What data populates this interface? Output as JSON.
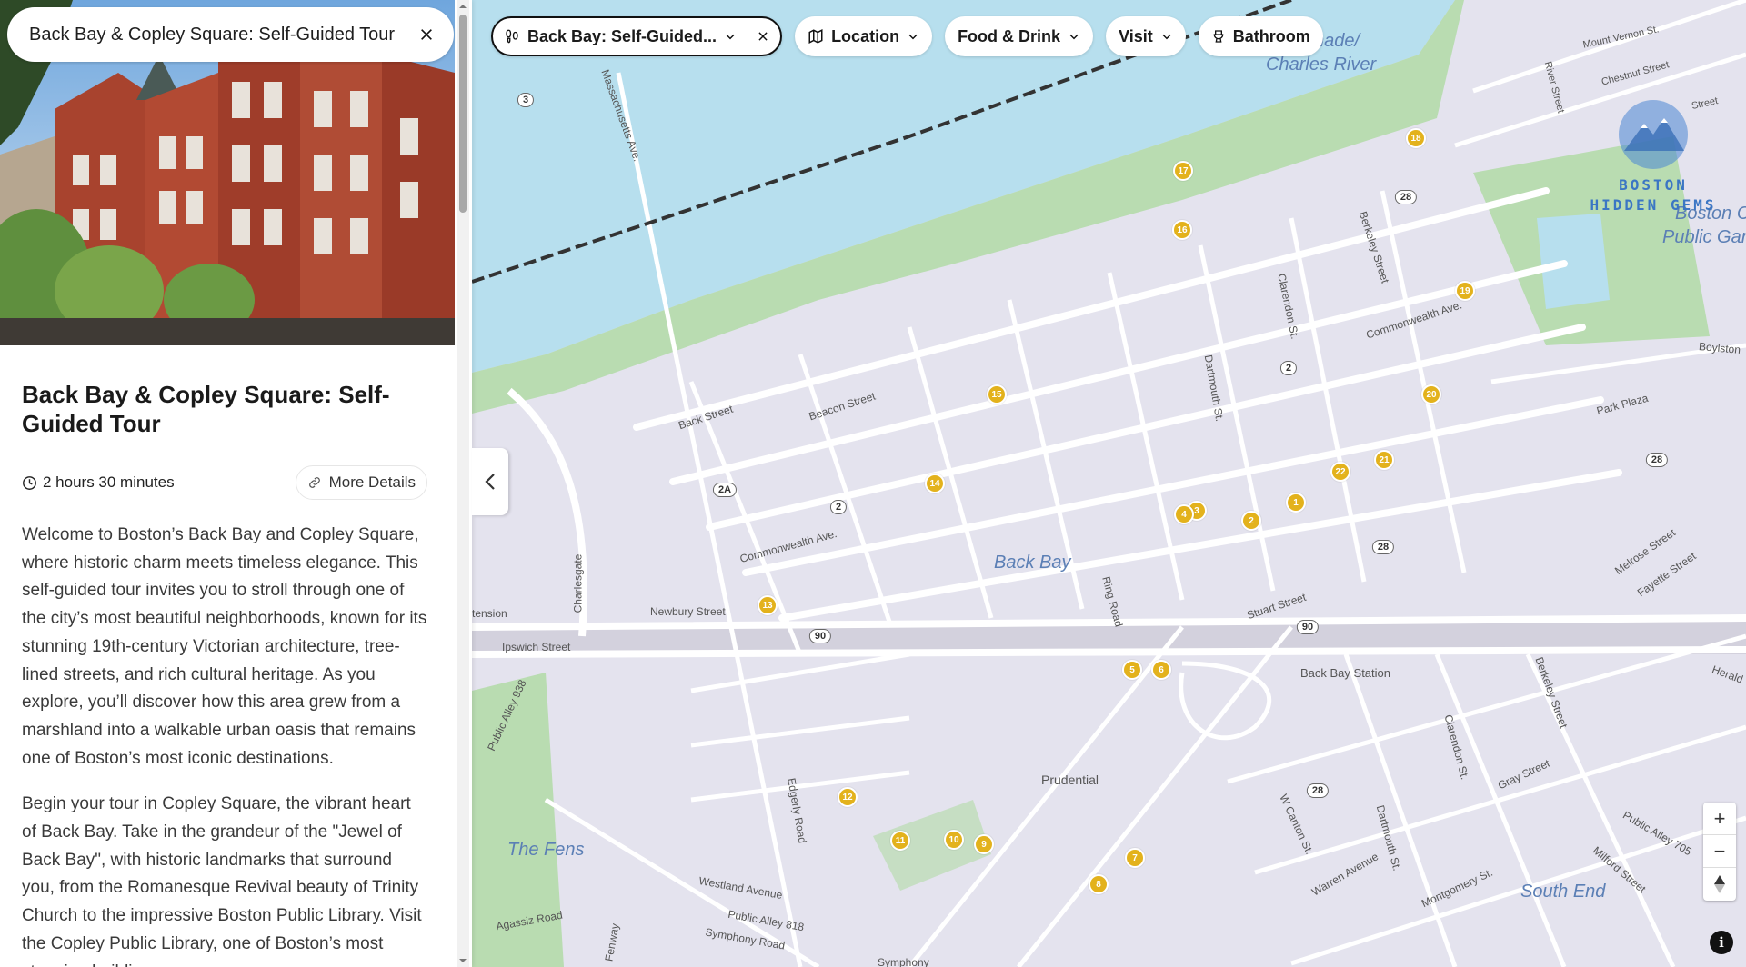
{
  "sidebar": {
    "title_pill": "Back Bay & Copley Square: Self-Guided Tour",
    "heading": "Back Bay & Copley Square: Self-Guided Tour",
    "duration": "2 hours 30 minutes",
    "more_details": "More Details",
    "paragraphs": [
      "Welcome to Boston’s Back Bay and Copley Square, where historic charm meets timeless elegance. This self-guided tour invites you to stroll through one of the city’s most beautiful neighborhoods, known for its stunning 19th-century Victorian architecture, tree-lined streets, and rich cultural heritage. As you explore, you’ll discover how this area grew from a marshland into a walkable urban oasis that remains one of Boston’s most iconic destinations.",
      "Begin your tour in Copley Square, the vibrant heart of Back Bay. Take in the grandeur of the \"Jewel of Back Bay\", with historic landmarks that surround you, from the Romanesque Revival beauty of Trinity Church to the impressive Boston Public Library. Visit the Copley Public Library, one of Boston’s most stunning buildings."
    ]
  },
  "filters": {
    "active_tour": "Back Bay: Self-Guided...",
    "location": "Location",
    "food_drink": "Food & Drink",
    "visit": "Visit",
    "bathroom": "Bathroom"
  },
  "map": {
    "markers": [
      "1",
      "2",
      "3",
      "4",
      "5",
      "6",
      "7",
      "8",
      "9",
      "10",
      "11",
      "12",
      "13",
      "14",
      "15",
      "16",
      "17",
      "18",
      "19",
      "20",
      "21",
      "22"
    ],
    "labels": {
      "esplanade": "Esplanade/",
      "charles_river": "Charles River",
      "back_bay": "Back Bay",
      "the_fens": "The Fens",
      "south_end": "South End",
      "boston_common": "Boston Com",
      "public_garden": "Public Gar",
      "back_street": "Back Street",
      "beacon_street": "Beacon Street",
      "commonwealth_ave": "Commonwealth Ave.",
      "commonwealth_ave2": "Commonwealth Ave.",
      "newbury_street": "Newbury Street",
      "ipswich_street": "Ipswich Street",
      "extension": "tension",
      "public_alley_938": "Public Alley 938",
      "charlesgate": "Charlesgate",
      "massachusetts_ave": "Massachusetts Ave.",
      "dartmouth_st": "Dartmouth St.",
      "clarendon_st": "Clarendon St.",
      "berkeley_street": "Berkeley Street",
      "ring_road": "Ring Road",
      "stuart_street": "Stuart Street",
      "back_bay_station": "Back Bay Station",
      "prudential": "Prudential",
      "edgerly_road": "Edgerly Road",
      "westland_avenue": "Westland Avenue",
      "public_alley_818": "Public Alley 818",
      "symphony_road": "Symphony Road",
      "agassiz_road": "Agassiz Road",
      "fenway": "Fenway",
      "symphony": "Symphony",
      "w_canton_st": "W Canton St.",
      "warren_avenue": "Warren Avenue",
      "dartmouth_st2": "Dartmouth St.",
      "clarendon_st2": "Clarendon St.",
      "berkeley_street2": "Berkeley Street",
      "gray_street": "Gray Street",
      "montgomery_st": "Montgomery St.",
      "public_alley_705": "Public Alley 705",
      "milford_street": "Milford Street",
      "melrose_street": "Melrose Street",
      "fayette_street": "Fayette Street",
      "herald": "Herald",
      "park_plaza": "Park Plaza",
      "boylston": "Boylston",
      "mount_vernon": "Mount Vernon St.",
      "chestnut_street": "Chestnut Street",
      "river_street": "River Street",
      "street_top": "Street"
    },
    "shields": [
      "3",
      "28",
      "2",
      "2A",
      "2",
      "90",
      "90",
      "28",
      "28",
      "28"
    ],
    "logo_line1": "BOSTON",
    "logo_line2": "HIDDEN GEMS",
    "colors": {
      "marker": "#e3b21c",
      "water": "#b7dfee",
      "park": "#b9dcb1",
      "land": "#e4e3ee",
      "road": "#ffffff"
    }
  },
  "zoom": {
    "plus": "+",
    "minus": "−"
  },
  "info": "i"
}
